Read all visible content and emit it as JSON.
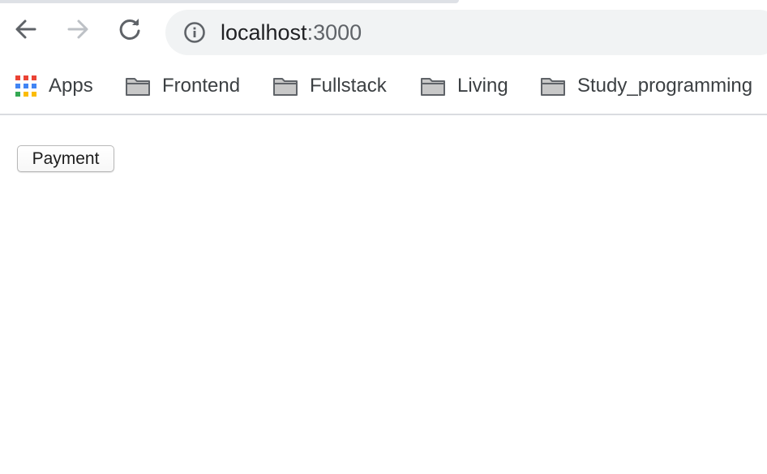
{
  "browser": {
    "address_bar": {
      "host": "localhost",
      "port": ":3000"
    },
    "bookmarks": [
      {
        "label": "Apps",
        "icon": "apps-grid-icon"
      },
      {
        "label": "Frontend",
        "icon": "folder-icon"
      },
      {
        "label": "Fullstack",
        "icon": "folder-icon"
      },
      {
        "label": "Living",
        "icon": "folder-icon"
      },
      {
        "label": "Study_programming",
        "icon": "folder-icon"
      }
    ]
  },
  "page": {
    "payment_button_label": "Payment"
  },
  "colors": {
    "omnibox_bg": "#f1f3f4",
    "apps_red": "#ea4335",
    "apps_blue": "#4285f4",
    "apps_yellow": "#fbbc04",
    "apps_green": "#34a853"
  }
}
